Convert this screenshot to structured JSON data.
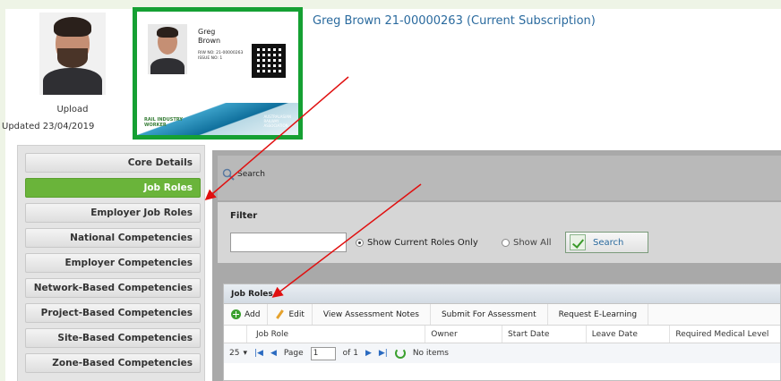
{
  "profile": {
    "upload_label": "Upload",
    "updated_label": "Updated 23/04/2019"
  },
  "card": {
    "first_name": "Greg",
    "last_name": "Brown",
    "rw_no": "RIW NO: 21-00000263",
    "issue_no": "ISSUE NO: 1",
    "rail_logo_1": "RAIL INDUSTRY",
    "rail_logo_2": "WORKER",
    "ara_logo_1": "AUSTRALASIAN",
    "ara_logo_2": "RAILWAY",
    "ara_logo_3": "ASSOCIATION",
    "accent_color": "#15a033"
  },
  "header": {
    "title": "Greg Brown 21-00000263 (Current Subscription)"
  },
  "sidebar": {
    "items": [
      {
        "label": "Core Details",
        "active": false
      },
      {
        "label": "Job Roles",
        "active": true
      },
      {
        "label": "Employer Job Roles",
        "active": false
      },
      {
        "label": "National Competencies",
        "active": false
      },
      {
        "label": "Employer Competencies",
        "active": false
      },
      {
        "label": "Network-Based Competencies",
        "active": false
      },
      {
        "label": "Project-Based Competencies",
        "active": false
      },
      {
        "label": "Site-Based Competencies",
        "active": false
      },
      {
        "label": "Zone-Based Competencies",
        "active": false
      }
    ],
    "active_color": "#6ab43a"
  },
  "search": {
    "toggle_label": "Search",
    "filter_label": "Filter",
    "input_value": "",
    "radio_current": "Show Current Roles Only",
    "radio_all": "Show All",
    "button_label": "Search"
  },
  "grid": {
    "title": "Job Roles",
    "toolbar": {
      "add": "Add",
      "edit": "Edit",
      "view_notes": "View Assessment Notes",
      "submit": "Submit For Assessment",
      "request": "Request E-Learning"
    },
    "columns": [
      "Job Role",
      "Owner",
      "Start Date",
      "Leave Date",
      "Required Medical Level"
    ],
    "pager": {
      "page_size": "25",
      "page_label": "Page",
      "page_value": "1",
      "of_label": "of 1",
      "status": "No items"
    }
  }
}
